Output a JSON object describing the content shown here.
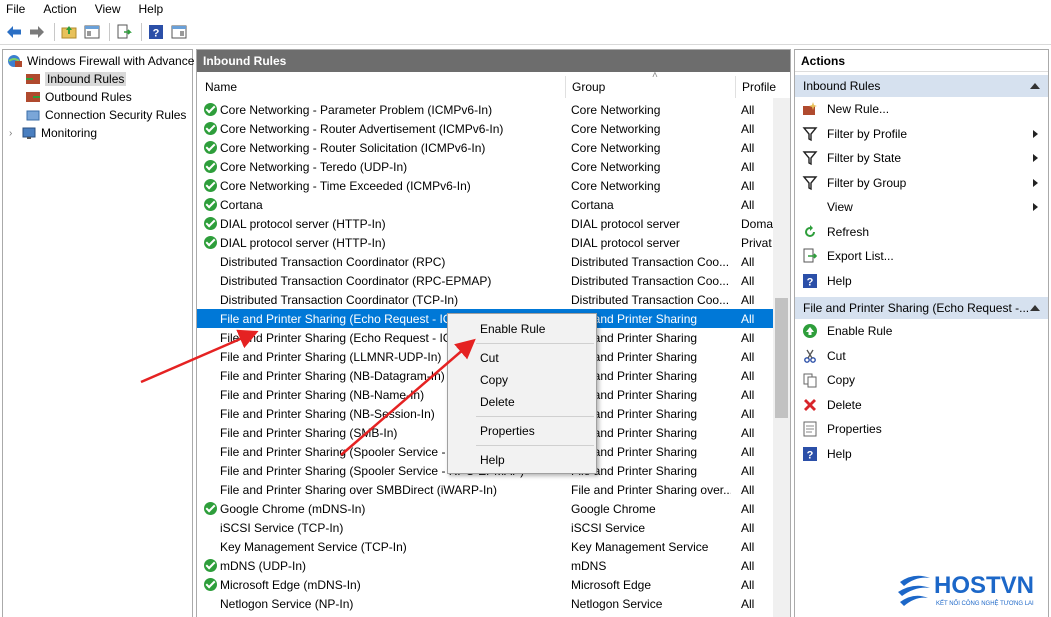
{
  "menu": [
    "File",
    "Action",
    "View",
    "Help"
  ],
  "tree": {
    "root": "Windows Firewall with Advance",
    "items": [
      "Inbound Rules",
      "Outbound Rules",
      "Connection Security Rules",
      "Monitoring"
    ]
  },
  "center": {
    "title": "Inbound Rules",
    "columns": {
      "name": "Name",
      "group": "Group",
      "profile": "Profile"
    },
    "rows": [
      {
        "name": "Core Networking - Parameter Problem (ICMPv6-In)",
        "group": "Core Networking",
        "profile": "All",
        "enabled": true
      },
      {
        "name": "Core Networking - Router Advertisement (ICMPv6-In)",
        "group": "Core Networking",
        "profile": "All",
        "enabled": true
      },
      {
        "name": "Core Networking - Router Solicitation (ICMPv6-In)",
        "group": "Core Networking",
        "profile": "All",
        "enabled": true
      },
      {
        "name": "Core Networking - Teredo (UDP-In)",
        "group": "Core Networking",
        "profile": "All",
        "enabled": true
      },
      {
        "name": "Core Networking - Time Exceeded (ICMPv6-In)",
        "group": "Core Networking",
        "profile": "All",
        "enabled": true
      },
      {
        "name": "Cortana",
        "group": "Cortana",
        "profile": "All",
        "enabled": true
      },
      {
        "name": "DIAL protocol server (HTTP-In)",
        "group": "DIAL protocol server",
        "profile": "Doma",
        "enabled": true
      },
      {
        "name": "DIAL protocol server (HTTP-In)",
        "group": "DIAL protocol server",
        "profile": "Privat",
        "enabled": true
      },
      {
        "name": "Distributed Transaction Coordinator (RPC)",
        "group": "Distributed Transaction Coo...",
        "profile": "All",
        "enabled": false
      },
      {
        "name": "Distributed Transaction Coordinator (RPC-EPMAP)",
        "group": "Distributed Transaction Coo...",
        "profile": "All",
        "enabled": false
      },
      {
        "name": "Distributed Transaction Coordinator (TCP-In)",
        "group": "Distributed Transaction Coo...",
        "profile": "All",
        "enabled": false
      },
      {
        "name": "File and Printer Sharing (Echo Request - ICMPv4-In)",
        "group": "File and Printer Sharing",
        "profile": "All",
        "enabled": false,
        "selected": true
      },
      {
        "name": "File and Printer Sharing (Echo Request - ICMPv6-In)",
        "group": "File and Printer Sharing",
        "profile": "All",
        "enabled": false
      },
      {
        "name": "File and Printer Sharing (LLMNR-UDP-In)",
        "group": "File and Printer Sharing",
        "profile": "All",
        "enabled": false
      },
      {
        "name": "File and Printer Sharing (NB-Datagram-In)",
        "group": "File and Printer Sharing",
        "profile": "All",
        "enabled": false
      },
      {
        "name": "File and Printer Sharing (NB-Name-In)",
        "group": "File and Printer Sharing",
        "profile": "All",
        "enabled": false
      },
      {
        "name": "File and Printer Sharing (NB-Session-In)",
        "group": "File and Printer Sharing",
        "profile": "All",
        "enabled": false
      },
      {
        "name": "File and Printer Sharing (SMB-In)",
        "group": "File and Printer Sharing",
        "profile": "All",
        "enabled": false
      },
      {
        "name": "File and Printer Sharing (Spooler Service - RPC)",
        "group": "File and Printer Sharing",
        "profile": "All",
        "enabled": false
      },
      {
        "name": "File and Printer Sharing (Spooler Service - RPC-EPMAP)",
        "group": "File and Printer Sharing",
        "profile": "All",
        "enabled": false
      },
      {
        "name": "File and Printer Sharing over SMBDirect (iWARP-In)",
        "group": "File and Printer Sharing over...",
        "profile": "All",
        "enabled": false
      },
      {
        "name": "Google Chrome (mDNS-In)",
        "group": "Google Chrome",
        "profile": "All",
        "enabled": true
      },
      {
        "name": "iSCSI Service (TCP-In)",
        "group": "iSCSI Service",
        "profile": "All",
        "enabled": false
      },
      {
        "name": "Key Management Service (TCP-In)",
        "group": "Key Management Service",
        "profile": "All",
        "enabled": false
      },
      {
        "name": "mDNS (UDP-In)",
        "group": "mDNS",
        "profile": "All",
        "enabled": true
      },
      {
        "name": "Microsoft Edge (mDNS-In)",
        "group": "Microsoft Edge",
        "profile": "All",
        "enabled": true
      },
      {
        "name": "Netlogon Service (NP-In)",
        "group": "Netlogon Service",
        "profile": "All",
        "enabled": false
      }
    ]
  },
  "context_menu": {
    "items": [
      "Enable Rule",
      "Cut",
      "Copy",
      "Delete",
      "Properties",
      "Help"
    ]
  },
  "actions": {
    "title": "Actions",
    "section1": {
      "title": "Inbound Rules",
      "items": [
        {
          "label": "New Rule...",
          "icon": "new-rule-icon"
        },
        {
          "label": "Filter by Profile",
          "icon": "filter-icon",
          "submenu": true
        },
        {
          "label": "Filter by State",
          "icon": "filter-icon",
          "submenu": true
        },
        {
          "label": "Filter by Group",
          "icon": "filter-icon",
          "submenu": true
        },
        {
          "label": "View",
          "icon": "",
          "submenu": true
        },
        {
          "label": "Refresh",
          "icon": "refresh-icon"
        },
        {
          "label": "Export List...",
          "icon": "export-icon"
        },
        {
          "label": "Help",
          "icon": "help-icon"
        }
      ]
    },
    "section2": {
      "title": "File and Printer Sharing (Echo Request -...",
      "items": [
        {
          "label": "Enable Rule",
          "icon": "enable-icon"
        },
        {
          "label": "Cut",
          "icon": "cut-icon"
        },
        {
          "label": "Copy",
          "icon": "copy-icon"
        },
        {
          "label": "Delete",
          "icon": "delete-icon"
        },
        {
          "label": "Properties",
          "icon": "properties-icon"
        },
        {
          "label": "Help",
          "icon": "help-icon"
        }
      ]
    }
  },
  "logo": {
    "brand": "HOSTVN",
    "tagline": "KẾT NỐI CÔNG NGHỆ TƯƠNG LAI"
  },
  "colors": {
    "selection": "#0078d7",
    "enabled_check": "#2e9e3b",
    "section_bg": "#d6e1ef",
    "brand": "#1c67c8",
    "annotation_arrow": "#e52222"
  }
}
